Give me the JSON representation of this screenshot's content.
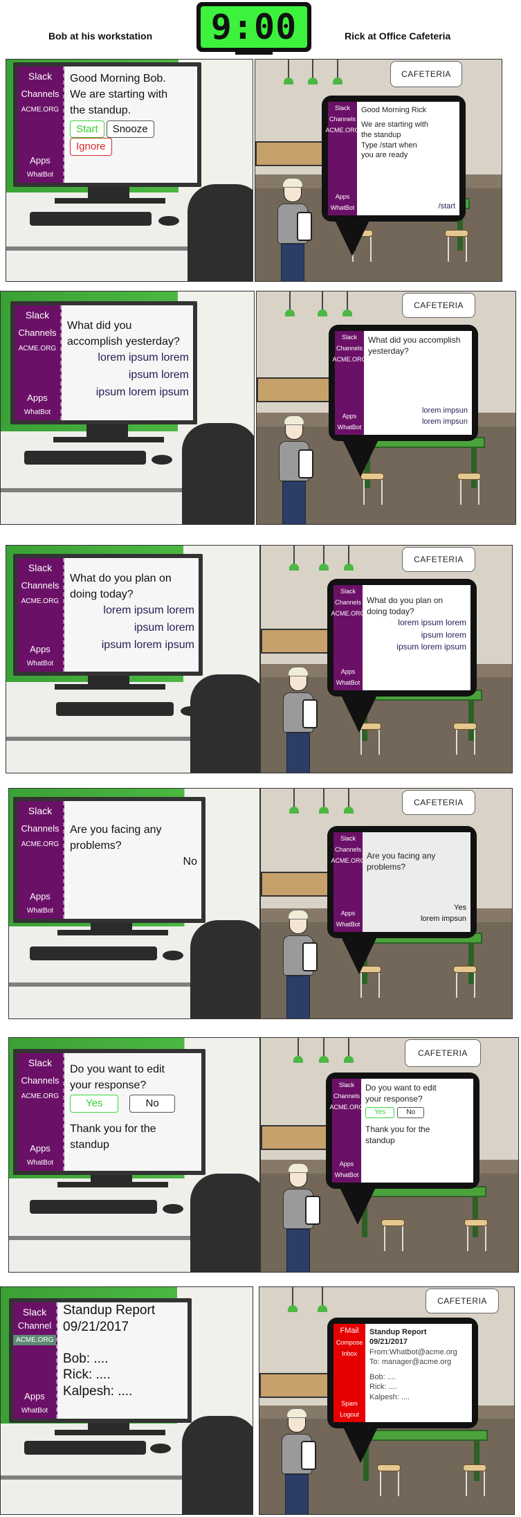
{
  "header": {
    "left_title": "Bob at his workstation",
    "right_title": "Rick at Office Cafeteria",
    "clock_time": "9:00"
  },
  "sidebar": {
    "slack": "Slack",
    "channels": "Channels",
    "channel_singular": "Channel",
    "org": "ACME.ORG",
    "apps": "Apps",
    "bot": "WhatBot"
  },
  "cafeteria_sign": "CAFETERIA",
  "panels": [
    {
      "bob": {
        "lines": [
          "Good Morning Bob.",
          "We are starting with",
          "the standup."
        ],
        "buttons": [
          "Start",
          "Snooze",
          "Ignore"
        ]
      },
      "rick": {
        "lines": [
          "Good Morning Rick",
          "We are starting with",
          "the standup",
          "Type /start when",
          "you are ready"
        ],
        "reply": "/start"
      }
    },
    {
      "bob": {
        "lines": [
          "What did you",
          "accomplish yesterday?"
        ],
        "answers": [
          "lorem ipsum lorem",
          "ipsum lorem",
          "ipsum lorem ipsum"
        ]
      },
      "rick": {
        "lines": [
          "What did you accomplish",
          "yesterday?"
        ],
        "answers": [
          "lorem impsun",
          "lorem impsun"
        ]
      }
    },
    {
      "bob": {
        "lines": [
          "What do you plan on",
          "doing today?"
        ],
        "answers": [
          "lorem ipsum lorem",
          "ipsum lorem",
          "ipsum lorem ipsum"
        ]
      },
      "rick": {
        "lines": [
          "What do you plan on",
          "doing today?"
        ],
        "answers": [
          "lorem ipsum lorem",
          "ipsum lorem",
          "ipsum lorem ipsum"
        ]
      }
    },
    {
      "bob": {
        "lines": [
          "Are you facing any",
          "problems?"
        ],
        "answers": [
          "No"
        ]
      },
      "rick": {
        "lines": [
          "Are you facing any",
          "problems?"
        ],
        "answers": [
          "Yes",
          "lorem impsun"
        ]
      }
    },
    {
      "bob": {
        "lines": [
          "Do you want to edit",
          "your response?"
        ],
        "buttons": [
          "Yes",
          "No"
        ],
        "thanks": [
          "Thank you for the",
          "standup"
        ]
      },
      "rick": {
        "lines": [
          "Do you want to edit",
          "your response?"
        ],
        "buttons": [
          "Yes",
          "No"
        ],
        "thanks": [
          "Thank you for the",
          "standup"
        ]
      }
    },
    {
      "bob": {
        "title": [
          "Standup Report",
          "09/21/2017"
        ],
        "entries": [
          "Bob: ....",
          "Rick: ....",
          "Kalpesh: ...."
        ]
      },
      "rick": {
        "mail_sidebar": [
          "FMail",
          "Compose",
          "Inbox",
          "Spam",
          "Logout"
        ],
        "title": [
          "Standup Report",
          "09/21/2017"
        ],
        "from": "From:Whatbot@acme.org",
        "to": "To: manager@acme.org",
        "entries": [
          "Bob: ....",
          "Rick: ....",
          "Kalpesh: ...."
        ]
      }
    }
  ],
  "colors": {
    "slack_purple": "#6b1067",
    "clock_green": "#3df23d",
    "button_green": "#34d134",
    "button_red": "#d42a2a",
    "fmail_red": "#e60000"
  }
}
